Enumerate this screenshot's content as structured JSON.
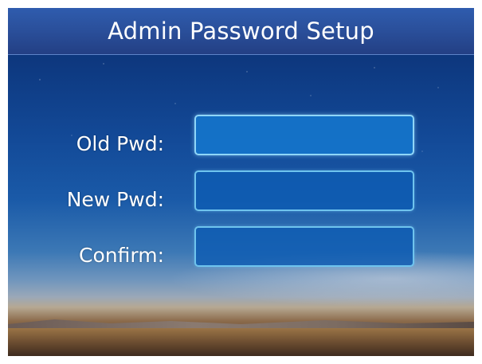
{
  "dialog": {
    "title": "Admin Password Setup"
  },
  "form": {
    "fields": [
      {
        "label": "Old Pwd:",
        "value": ""
      },
      {
        "label": "New Pwd:",
        "value": ""
      },
      {
        "label": "Confirm:",
        "value": ""
      }
    ]
  },
  "theme": {
    "title_bar_color": "#2a4f9a",
    "field_border_color": "#6fc4ee",
    "field_fill_color": "#0e5cb2",
    "text_color": "#ffffff"
  }
}
